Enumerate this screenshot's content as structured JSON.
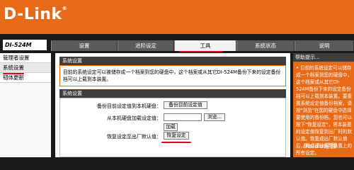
{
  "brand": {
    "name": "D-Link",
    "registered": "®"
  },
  "model": "DI-524M",
  "tabs": [
    {
      "label": "设置",
      "active": false
    },
    {
      "label": "进阶设定",
      "active": false
    },
    {
      "label": "工具",
      "active": true
    },
    {
      "label": "系统状态",
      "active": false
    },
    {
      "label": "说明",
      "active": false
    }
  ],
  "sidebar": {
    "items": [
      {
        "label": "管理者设置",
        "active": false
      },
      {
        "label": "系统设置",
        "active": true
      },
      {
        "label": "韧体更新",
        "active": false
      }
    ]
  },
  "main": {
    "panel1": {
      "title": "系统设置",
      "intro": "目前的系统设定可以被储存成一个档案到您的硬盘中，这个档案或从其它DI-524M备份下来的设定备份档可以上载到本装置。"
    },
    "panel2": {
      "title": "系统设置",
      "rows": {
        "save_label": "备份目前设定值到本机硬盘：",
        "save_button": "备份目前设定值",
        "load_label": "从本机硬盘加载设定值：",
        "load_input_value": "",
        "browse_button": "浏览...",
        "load_button": "加载",
        "restore_label": "恢复设定至出厂默认值：",
        "restore_button": "恢复设定"
      }
    }
  },
  "help": {
    "title": "帮助提示...",
    "text": "• 目前的系统设定可以储存成一个档案到您的硬盘中，这个档案或从其它DI-524M备份下来的设定备份档可以上载到本装置。要重置系统设定值备份档案，请按\"浏览\"在您的硬盘中选择要使用的备份档，您也可以按下\"恢复设定\"，将本装置的设定值恢复到出厂时的默认值。恢复成出厂默认值后，将会清除掉本装置上的所有设定。"
  },
  "watermark": "Baidu经验",
  "colors": {
    "brand_orange": "#e76a18",
    "dark": "#1a1a1a",
    "tab_gray": "#5b5b5b",
    "annotation_red": "#e0001b"
  }
}
